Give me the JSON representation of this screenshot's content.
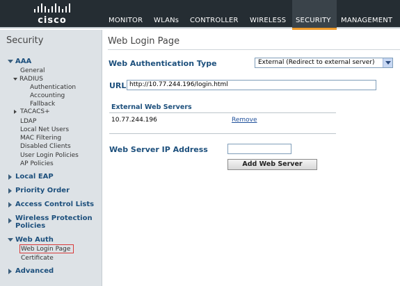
{
  "header": {
    "logo_text": "cisco",
    "nav": [
      {
        "label": "MONITOR"
      },
      {
        "label": "WLANs"
      },
      {
        "label": "CONTROLLER"
      },
      {
        "label": "WIRELESS"
      },
      {
        "label": "SECURITY",
        "active": true
      },
      {
        "label": "MANAGEMENT"
      }
    ]
  },
  "sidebar": {
    "title": "Security",
    "aaa": "AAA",
    "aaa_general": "General",
    "radius": "RADIUS",
    "radius_auth": "Authentication",
    "radius_acct": "Accounting",
    "radius_fallback": "Fallback",
    "tacacs": "TACACS+",
    "ldap": "LDAP",
    "local_net_users": "Local Net Users",
    "mac_filtering": "MAC Filtering",
    "disabled_clients": "Disabled Clients",
    "user_login_policies": "User Login Policies",
    "ap_policies": "AP Policies",
    "local_eap": "Local EAP",
    "priority_order": "Priority Order",
    "acl": "Access Control Lists",
    "wpp_line1": "Wireless Protection",
    "wpp_line2": "Policies",
    "web_auth": "Web Auth",
    "web_login_page": "Web Login Page",
    "certificate": "Certificate",
    "advanced": "Advanced"
  },
  "main": {
    "title": "Web Login Page",
    "auth_type_label": "Web Authentication Type",
    "auth_type_value": "External (Redirect to external server)",
    "url_label": "URL",
    "url_value": "http://10.77.244.196/login.html",
    "servers_title": "External Web Servers",
    "servers": [
      {
        "ip": "10.77.244.196",
        "action": "Remove"
      }
    ],
    "ip_label": "Web Server IP Address",
    "ip_value": "",
    "add_button": "Add Web Server"
  },
  "colors": {
    "header_bg": "#252d33",
    "active_tab_accent": "#ee9a2b",
    "sidebar_bg": "#dde2e6",
    "section_text": "#1c4f7c"
  }
}
